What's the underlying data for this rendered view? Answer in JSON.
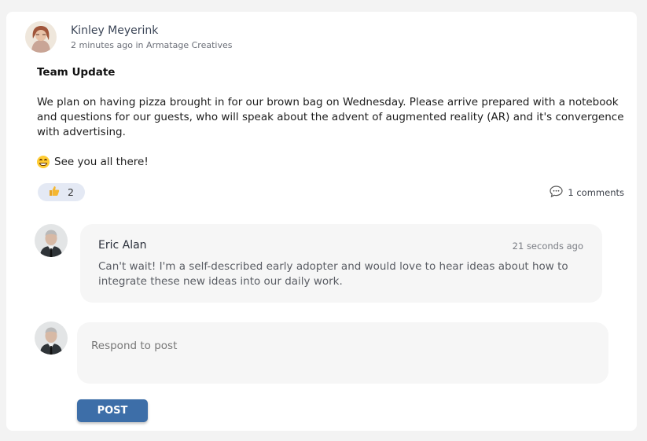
{
  "post": {
    "author_name": "Kinley Meyerink",
    "meta": "2 minutes ago in Armatage Creatives",
    "title": "Team Update",
    "body": "We plan on having pizza brought in for our brown bag on Wednesday.  Please arrive prepared with a notebook and questions for our guests, who will speak about the advent of augmented reality (AR) and it's convergence with advertising.",
    "closing": "See you all there!",
    "closing_emoji": "grinning-face-emoji",
    "reaction_icon": "thumbs-up-icon",
    "reaction_count": "2",
    "comments_label": "1 comments"
  },
  "comment": {
    "author_name": "Eric Alan",
    "time": "21 seconds ago",
    "text": "Can't wait!  I'm a self-described early adopter and would love to hear ideas about how to integrate these new ideas into our daily work."
  },
  "reply": {
    "placeholder": "Respond to post",
    "button_label": "POST"
  },
  "colors": {
    "accent": "#3d6ea8",
    "reaction_bg": "#e4e9f4",
    "comment_bg": "#f6f6f6"
  }
}
